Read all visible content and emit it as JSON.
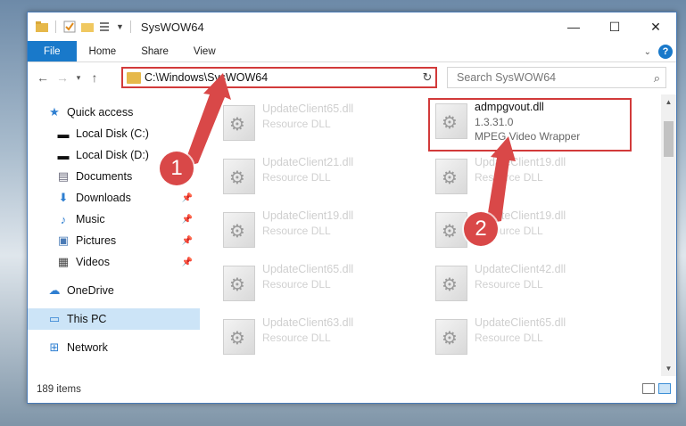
{
  "window": {
    "title": "SysWOW64",
    "controls": {
      "minimize": "—",
      "maximize": "☐",
      "close": "✕"
    }
  },
  "ribbon": {
    "tabs": [
      {
        "label": "File"
      },
      {
        "label": "Home"
      },
      {
        "label": "Share"
      },
      {
        "label": "View"
      }
    ],
    "help": "?"
  },
  "nav": {
    "address": "C:\\Windows\\SysWOW64",
    "search_placeholder": "Search SysWOW64"
  },
  "sidebar": {
    "items": [
      {
        "label": "Quick access",
        "icon": "star-icon"
      },
      {
        "label": "Local Disk (C:)",
        "icon": "drive-icon"
      },
      {
        "label": "Local Disk (D:)",
        "icon": "drive-icon"
      },
      {
        "label": "Documents",
        "icon": "documents-icon"
      },
      {
        "label": "Downloads",
        "icon": "download-icon"
      },
      {
        "label": "Music",
        "icon": "music-icon"
      },
      {
        "label": "Pictures",
        "icon": "pictures-icon"
      },
      {
        "label": "Videos",
        "icon": "videos-icon"
      },
      {
        "label": "OneDrive",
        "icon": "cloud-icon"
      },
      {
        "label": "This PC",
        "icon": "computer-icon"
      },
      {
        "label": "Network",
        "icon": "network-icon"
      }
    ]
  },
  "files": [
    {
      "name": "UpdateClient65.dll",
      "desc": "Resource DLL"
    },
    {
      "name": "admpgvout.dll",
      "version": "1.3.31.0",
      "desc": "MPEG Video Wrapper"
    },
    {
      "name": "UpdateClient21.dll",
      "desc": "Resource DLL"
    },
    {
      "name": "UpdateClient19.dll",
      "desc": "Resource DLL"
    },
    {
      "name": "UpdateClient19.dll",
      "desc": "Resource DLL"
    },
    {
      "name": "UpdateClient19.dll",
      "desc": "Resource DLL"
    },
    {
      "name": "UpdateClient65.dll",
      "desc": "Resource DLL"
    },
    {
      "name": "UpdateClient42.dll",
      "desc": "Resource DLL"
    },
    {
      "name": "UpdateClient63.dll",
      "desc": "Resource DLL"
    },
    {
      "name": "UpdateClient65.dll",
      "desc": "Resource DLL"
    }
  ],
  "status": {
    "count": "189 items"
  },
  "annotations": {
    "step1": "1",
    "step2": "2"
  },
  "colors": {
    "accent": "#1979ca",
    "highlight": "#d23a3a"
  }
}
